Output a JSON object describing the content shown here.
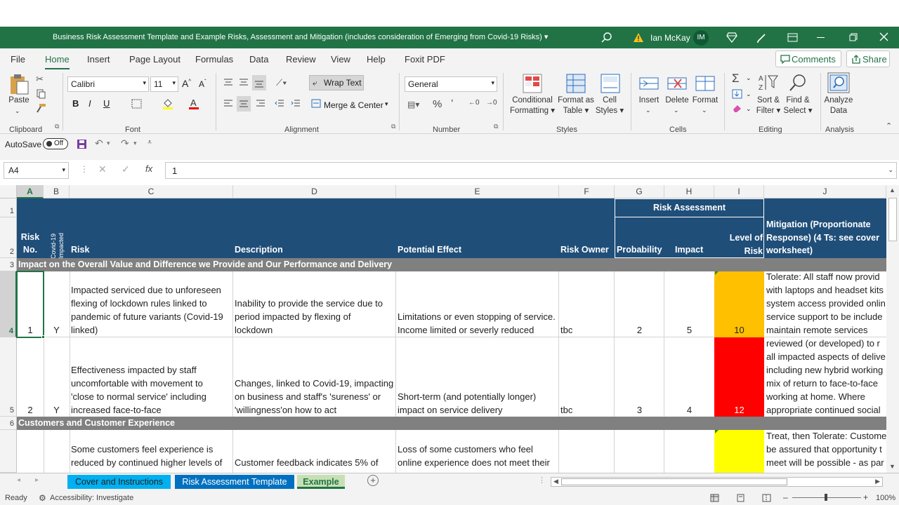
{
  "window": {
    "title": "Business Risk Assessment Template and Example Risks, Assessment and Mitigation (includes consideration of Emerging from Covid-19 Risks) ▾",
    "user_name": "Ian McKay",
    "user_initials": "IM"
  },
  "tabs": [
    "File",
    "Home",
    "Insert",
    "Page Layout",
    "Formulas",
    "Data",
    "Review",
    "View",
    "Help",
    "Foxit PDF"
  ],
  "ribbon_actions": {
    "comments": "Comments",
    "share": "Share"
  },
  "clipboard": {
    "paste": "Paste",
    "group": "Clipboard"
  },
  "font": {
    "name": "Calibri",
    "size": "11",
    "group": "Font"
  },
  "alignment": {
    "wrap": "Wrap Text",
    "merge": "Merge & Center",
    "group": "Alignment"
  },
  "number": {
    "format": "General",
    "group": "Number"
  },
  "styles": {
    "cond1": "Conditional",
    "cond2": "Formatting",
    "fmt1": "Format as",
    "fmt2": "Table",
    "cell1": "Cell",
    "cell2": "Styles",
    "group": "Styles"
  },
  "cells": {
    "insert": "Insert",
    "delete": "Delete",
    "format": "Format",
    "group": "Cells"
  },
  "editing": {
    "sort1": "Sort &",
    "sort2": "Filter",
    "find1": "Find &",
    "find2": "Select",
    "group": "Editing"
  },
  "analysis": {
    "a1": "Analyze",
    "a2": "Data",
    "group": "Analysis"
  },
  "qat": {
    "autosave": "AutoSave",
    "toggle": "Off"
  },
  "formula_bar": {
    "name_box": "A4",
    "formula": "1",
    "fx": "fx"
  },
  "columns": [
    "A",
    "B",
    "C",
    "D",
    "E",
    "F",
    "G",
    "H",
    "I",
    "J"
  ],
  "rows": [
    "1",
    "2",
    "3",
    "4",
    "5",
    "6"
  ],
  "headers": {
    "risk_assessment": "Risk Assessment",
    "risk_no_1": "Risk",
    "risk_no_2": "No.",
    "covid_1": "Covid-19",
    "covid_2": "Impacted",
    "risk": "Risk",
    "description": "Description",
    "potential_effect": "Potential Effect",
    "risk_owner": "Risk Owner",
    "probability": "Probability",
    "impact": "Impact",
    "level_1": "Level of",
    "level_2": "Risk",
    "mitigation_1": "Mitigation (Proportionate",
    "mitigation_2": "Response) (4 Ts: see cover",
    "mitigation_3": "worksheet)"
  },
  "sections": {
    "s3": "Impact on the Overall Value and Difference we Provide and Our Performance and Delivery",
    "s6": "Customers and Customer Experience"
  },
  "row4": {
    "no": "1",
    "covid": "Y",
    "risk": [
      "Impacted serviced due to unforeseen",
      "flexing of lockdown rules linked to",
      "pandemic of future variants (Covid-19",
      "linked)"
    ],
    "description": [
      "Inability to provide the service due to",
      "period impacted by flexing of",
      "lockdown"
    ],
    "effect": [
      "Limitations or even stopping of service.",
      "Income limited or severly reduced"
    ],
    "owner": "tbc",
    "probability": "2",
    "impact": "5",
    "level": "10",
    "level_color": "#ffc000",
    "mitigation": [
      "Tolerate: All staff now provid",
      "with laptops and headset kits",
      "system access provided onlin",
      "service support to be include",
      "maintain remote services"
    ]
  },
  "row5": {
    "no": "2",
    "covid": "Y",
    "risk": [
      "Effectiveness impacted by staff",
      "uncomfortable with movement to",
      "'close to normal service' including",
      "increased face-to-face"
    ],
    "description": [
      "Changes, linked to Covid-19, impacting",
      "on business and staff's 'sureness' or",
      "'willingness'on how to act"
    ],
    "effect": [
      "Short-term (and potentially longer)",
      "impact on service delivery"
    ],
    "owner": "tbc",
    "probability": "3",
    "impact": "4",
    "level": "12",
    "level_color": "#ff0000",
    "mitigation": [
      "reviewed (or developed) to r",
      "all impacted aspects of delive",
      "including new hybrid working",
      "mix of return to face-to-face",
      "working at home. Where",
      "appropriate continued social"
    ]
  },
  "row7": {
    "risk": [
      "Some customers feel experience is",
      "reduced by continued higher levels of"
    ],
    "description": [
      "Customer feedback indicates 5% of"
    ],
    "effect": [
      "Loss of some customers who feel",
      "online experience does not meet their"
    ],
    "level_color": "#ffff00",
    "mitigation": [
      "Treat, then Tolerate: Custome",
      "be assured that opportunity t",
      "meet will be possible - as par"
    ]
  },
  "sheet_tabs": [
    "Cover and Instructions",
    "Risk Assessment Template",
    "Example"
  ],
  "status": {
    "ready": "Ready",
    "accessibility": "Accessibility: Investigate",
    "zoom": "100%"
  }
}
